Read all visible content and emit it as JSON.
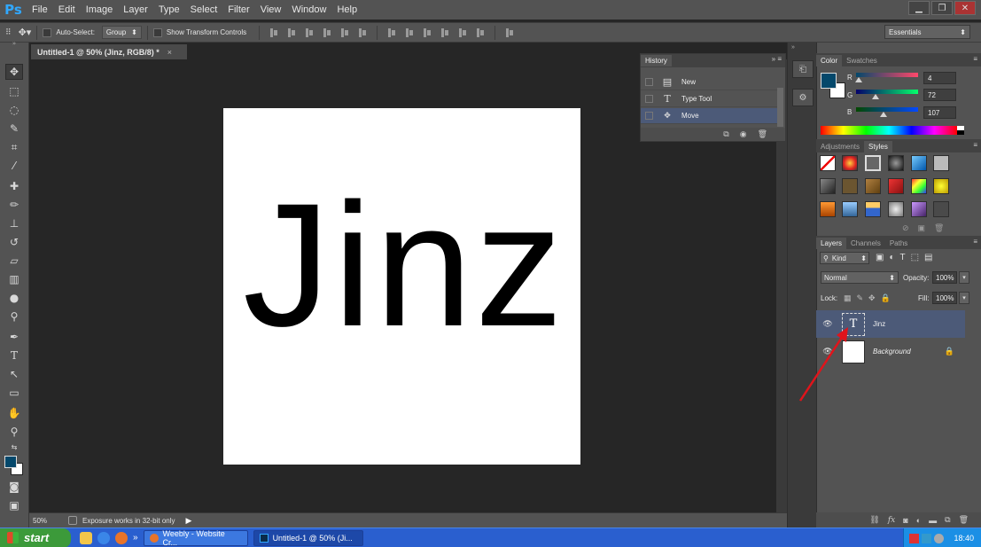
{
  "menubar": {
    "logo": "Ps",
    "items": [
      "File",
      "Edit",
      "Image",
      "Layer",
      "Type",
      "Select",
      "Filter",
      "View",
      "Window",
      "Help"
    ]
  },
  "window_controls": {
    "minimize": "▁",
    "restore": "❐",
    "close": "✕"
  },
  "options": {
    "auto_select_label": "Auto-Select:",
    "auto_select_value": "Group",
    "show_transform_label": "Show Transform Controls"
  },
  "workspace": {
    "value": "Essentials"
  },
  "document": {
    "tab_title": "Untitled-1 @ 50% (Jinz, RGB/8) *",
    "tab_close": "×",
    "canvas_text": "Jinz"
  },
  "status": {
    "zoom": "50%",
    "message": "Exposure works in 32-bit only",
    "arrow": "▶"
  },
  "history": {
    "tab": "History",
    "items": [
      {
        "label": "New",
        "icon": "document-icon"
      },
      {
        "label": "Type Tool",
        "icon": "type-tool-icon"
      },
      {
        "label": "Move",
        "icon": "move-tool-icon",
        "selected": true
      }
    ]
  },
  "color_panel": {
    "tabs": [
      "Color",
      "Swatches"
    ],
    "r_label": "R",
    "r_value": "4",
    "g_label": "G",
    "g_value": "72",
    "b_label": "B",
    "b_value": "107",
    "fg_color": "#04486b",
    "bg_color": "#ffffff"
  },
  "styles_panel": {
    "tabs": [
      "Adjustments",
      "Styles"
    ]
  },
  "layers_panel": {
    "tabs": [
      "Layers",
      "Channels",
      "Paths"
    ],
    "kind_label": "Kind",
    "blend_mode": "Normal",
    "opacity_label": "Opacity:",
    "opacity_value": "100%",
    "lock_label": "Lock:",
    "fill_label": "Fill:",
    "fill_value": "100%",
    "layers": [
      {
        "name": "Jinz",
        "type": "text",
        "selected": true
      },
      {
        "name": "Background",
        "type": "background",
        "locked": true
      }
    ]
  },
  "taskbar": {
    "start_label": "start",
    "tasks": [
      "Weebly - Website Cr...",
      "Untitled-1 @ 50% (Ji..."
    ],
    "chevron": "»",
    "clock": "18:40"
  },
  "colors": {
    "accent_selection": "#4c5a78",
    "annotation_arrow": "#e0141b"
  }
}
